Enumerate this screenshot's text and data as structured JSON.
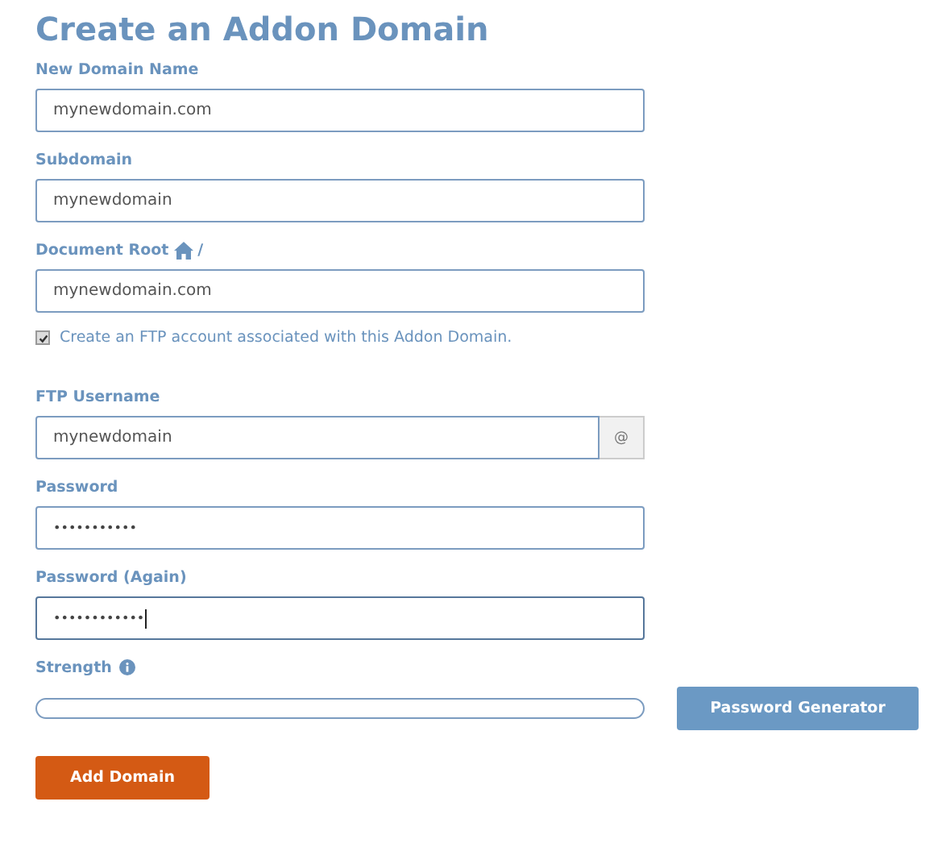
{
  "title": "Create an Addon Domain",
  "fields": [
    {
      "label": "New Domain Name",
      "value": "mynewdomain.com"
    },
    {
      "label": "Subdomain",
      "value": "mynewdomain"
    },
    {
      "label": "Document Root",
      "label_suffix": "/",
      "value": "mynewdomain.com"
    }
  ],
  "ftp_checkbox": {
    "label": "Create an FTP account associated with this Addon Domain.",
    "checked": true
  },
  "ftp_username": {
    "label": "FTP Username",
    "value": "mynewdomain",
    "addon": "@"
  },
  "passwords": [
    {
      "label": "Password",
      "value": "•••••••••••",
      "focused": false
    },
    {
      "label": "Password (Again)",
      "value": "••••••••••••",
      "focused": true
    }
  ],
  "strength": {
    "label": "Strength",
    "level": 0
  },
  "buttons": {
    "generator": "Password Generator",
    "submit": "Add Domain"
  }
}
